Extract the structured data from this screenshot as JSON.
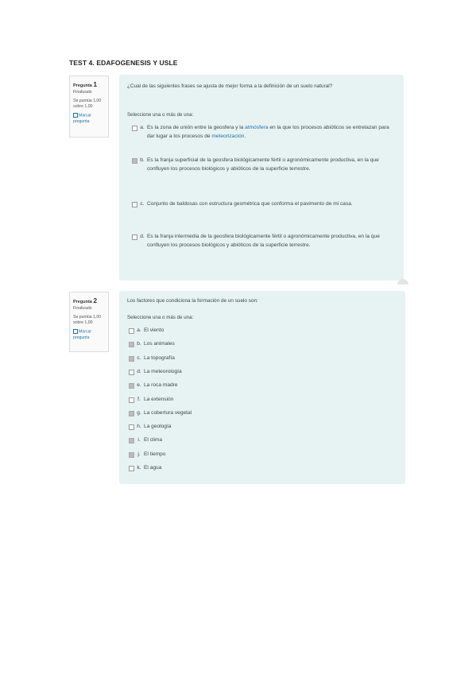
{
  "title": "TEST 4. EDAFOGENESIS Y USLE",
  "q1": {
    "label": "Pregunta",
    "num": "1",
    "status": "Finalizado",
    "score": "Se puntúa 1,00 sobre 1,00",
    "flag": "Marcar pregunta",
    "text": "¿Cual de las siguientes frases se ajusta de mejor forma a la definición de un suelo natural?",
    "prompt": "Seleccione una o más de una:",
    "options": [
      {
        "letter": "a.",
        "text_pre": "Es la zona de unión entre la geosfera y la ",
        "link1": "atmósfera",
        "text_mid": " en la que los procesos abióticos se entrelazan para dar lugar a los procesos de ",
        "link2": "meteorización",
        "text_post": "."
      },
      {
        "letter": "b.",
        "text": "Es la franja superficial de la geosfera biológicamente fértil o agronómicamente productiva, en la que confluyen los procesos biológicos y abióticos de la superficie terrestre."
      },
      {
        "letter": "c.",
        "text": "Conjunto de baldosas con estructura geométrica que conforma el pavimento de mi casa."
      },
      {
        "letter": "d.",
        "text": "Es la franja intermedia de la geosfera biológicamente fértil o agronómicamente productiva, en la que confluyen los procesos biológicos y abióticos de la superficie terrestre."
      }
    ]
  },
  "q2": {
    "label": "Pregunta",
    "num": "2",
    "status": "Finalizado",
    "score": "Se puntúa 1,00 sobre 1,00",
    "flag": "Marcar pregunta",
    "text": "Los factores que condiciona la formación de un suelo son:",
    "prompt": "Seleccione una o más de una:",
    "options": [
      {
        "letter": "a.",
        "text": "El viento",
        "checked": false
      },
      {
        "letter": "b.",
        "text": "Los animales",
        "checked": true
      },
      {
        "letter": "c.",
        "text": "La topografía",
        "checked": true
      },
      {
        "letter": "d.",
        "text": "La meteorología",
        "checked": false
      },
      {
        "letter": "e.",
        "text": "La roca madre",
        "checked": true
      },
      {
        "letter": "f.",
        "text": "La extensión",
        "checked": false
      },
      {
        "letter": "g.",
        "text": "La cobertura vegetal",
        "checked": true
      },
      {
        "letter": "h.",
        "text": "La geología",
        "checked": false
      },
      {
        "letter": "i.",
        "text": "El clima",
        "checked": true
      },
      {
        "letter": "j.",
        "text": "El tiempo",
        "checked": true
      },
      {
        "letter": "k.",
        "text": "El agua",
        "checked": false
      }
    ]
  }
}
